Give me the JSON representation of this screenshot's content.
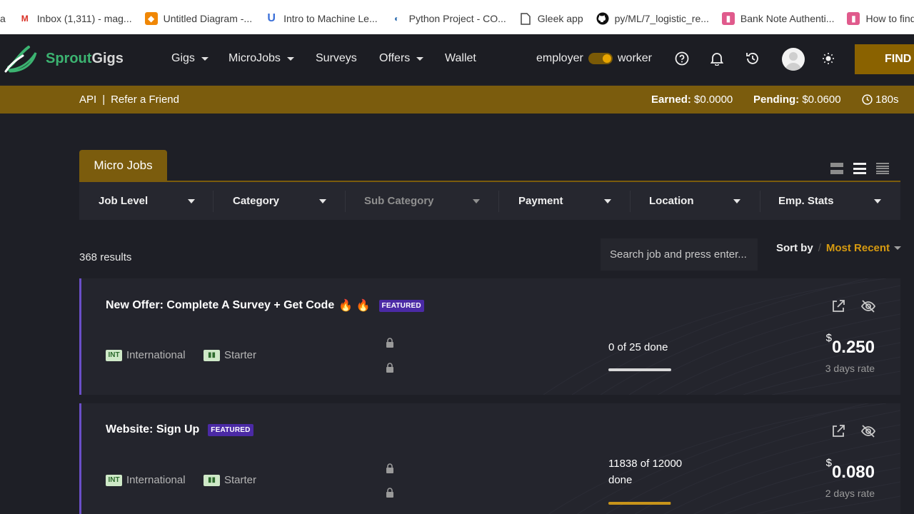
{
  "bookmarks": [
    {
      "label": "Inbox (1,311) - mag...",
      "icon": "gmail-icon",
      "color": "#d93025"
    },
    {
      "label": "Untitled Diagram -...",
      "icon": "diagram-icon",
      "color": "#f08705"
    },
    {
      "label": "Intro to Machine Le...",
      "icon": "udemy-icon",
      "color": "#3a6fd8"
    },
    {
      "label": "Python Project - CO...",
      "icon": "colab-icon",
      "color": "#2b6cb0"
    },
    {
      "label": "Gleek app",
      "icon": "document-icon",
      "color": "#444444"
    },
    {
      "label": "py/ML/7_logistic_re...",
      "icon": "github-icon",
      "color": "#111111"
    },
    {
      "label": "Bank Note Authenti...",
      "icon": "kaggle-icon",
      "color": "#d6336c"
    },
    {
      "label": "How to find the mo...",
      "icon": "kaggle-icon",
      "color": "#d6336c"
    }
  ],
  "bookmark_lead": "a",
  "brand": {
    "part1": "Sprout",
    "part2": "Gigs",
    "accent": "#3cb371"
  },
  "nav": {
    "gigs": "Gigs",
    "microjobs": "MicroJobs",
    "surveys": "Surveys",
    "offers": "Offers",
    "wallet": "Wallet",
    "employer": "employer",
    "worker": "worker",
    "find": "FIND"
  },
  "subbar": {
    "api": "API",
    "separator": "|",
    "refer": "Refer a Friend",
    "earned_label": "Earned:",
    "earned_value": "$0.0000",
    "pending_label": "Pending:",
    "pending_value": "$0.0600",
    "timer": "180s"
  },
  "tab": {
    "label": "Micro Jobs"
  },
  "filters": {
    "job_level": "Job Level",
    "category": "Category",
    "sub_category": "Sub Category",
    "payment": "Payment",
    "location": "Location",
    "emp_stats": "Emp. Stats"
  },
  "results": {
    "count": "368 results"
  },
  "search": {
    "placeholder": "Search job and press enter..."
  },
  "sort": {
    "label": "Sort by",
    "slash": "/",
    "value": "Most Recent"
  },
  "jobs": [
    {
      "title": "New Offer: Complete A Survey + Get Code",
      "emoji": "🔥 🔥",
      "badge": "FEATURED",
      "location_code": "INT",
      "location": "International",
      "level": "Starter",
      "done": "0 of 25 done",
      "progress": 0.0,
      "currency": "$",
      "price": "0.250",
      "rate": "3 days rate"
    },
    {
      "title": "Website: Sign Up",
      "emoji": "",
      "badge": "FEATURED",
      "location_code": "INT",
      "location": "International",
      "level": "Starter",
      "done": "11838 of 12000 done",
      "progress": 0.9865,
      "currency": "$",
      "price": "0.080",
      "rate": "2 days rate"
    }
  ],
  "colors": {
    "gold": "#7b5c0d",
    "accent_orange": "#d69a10",
    "featured": "#4b2aa5",
    "card_border": "#6b4fc8"
  }
}
